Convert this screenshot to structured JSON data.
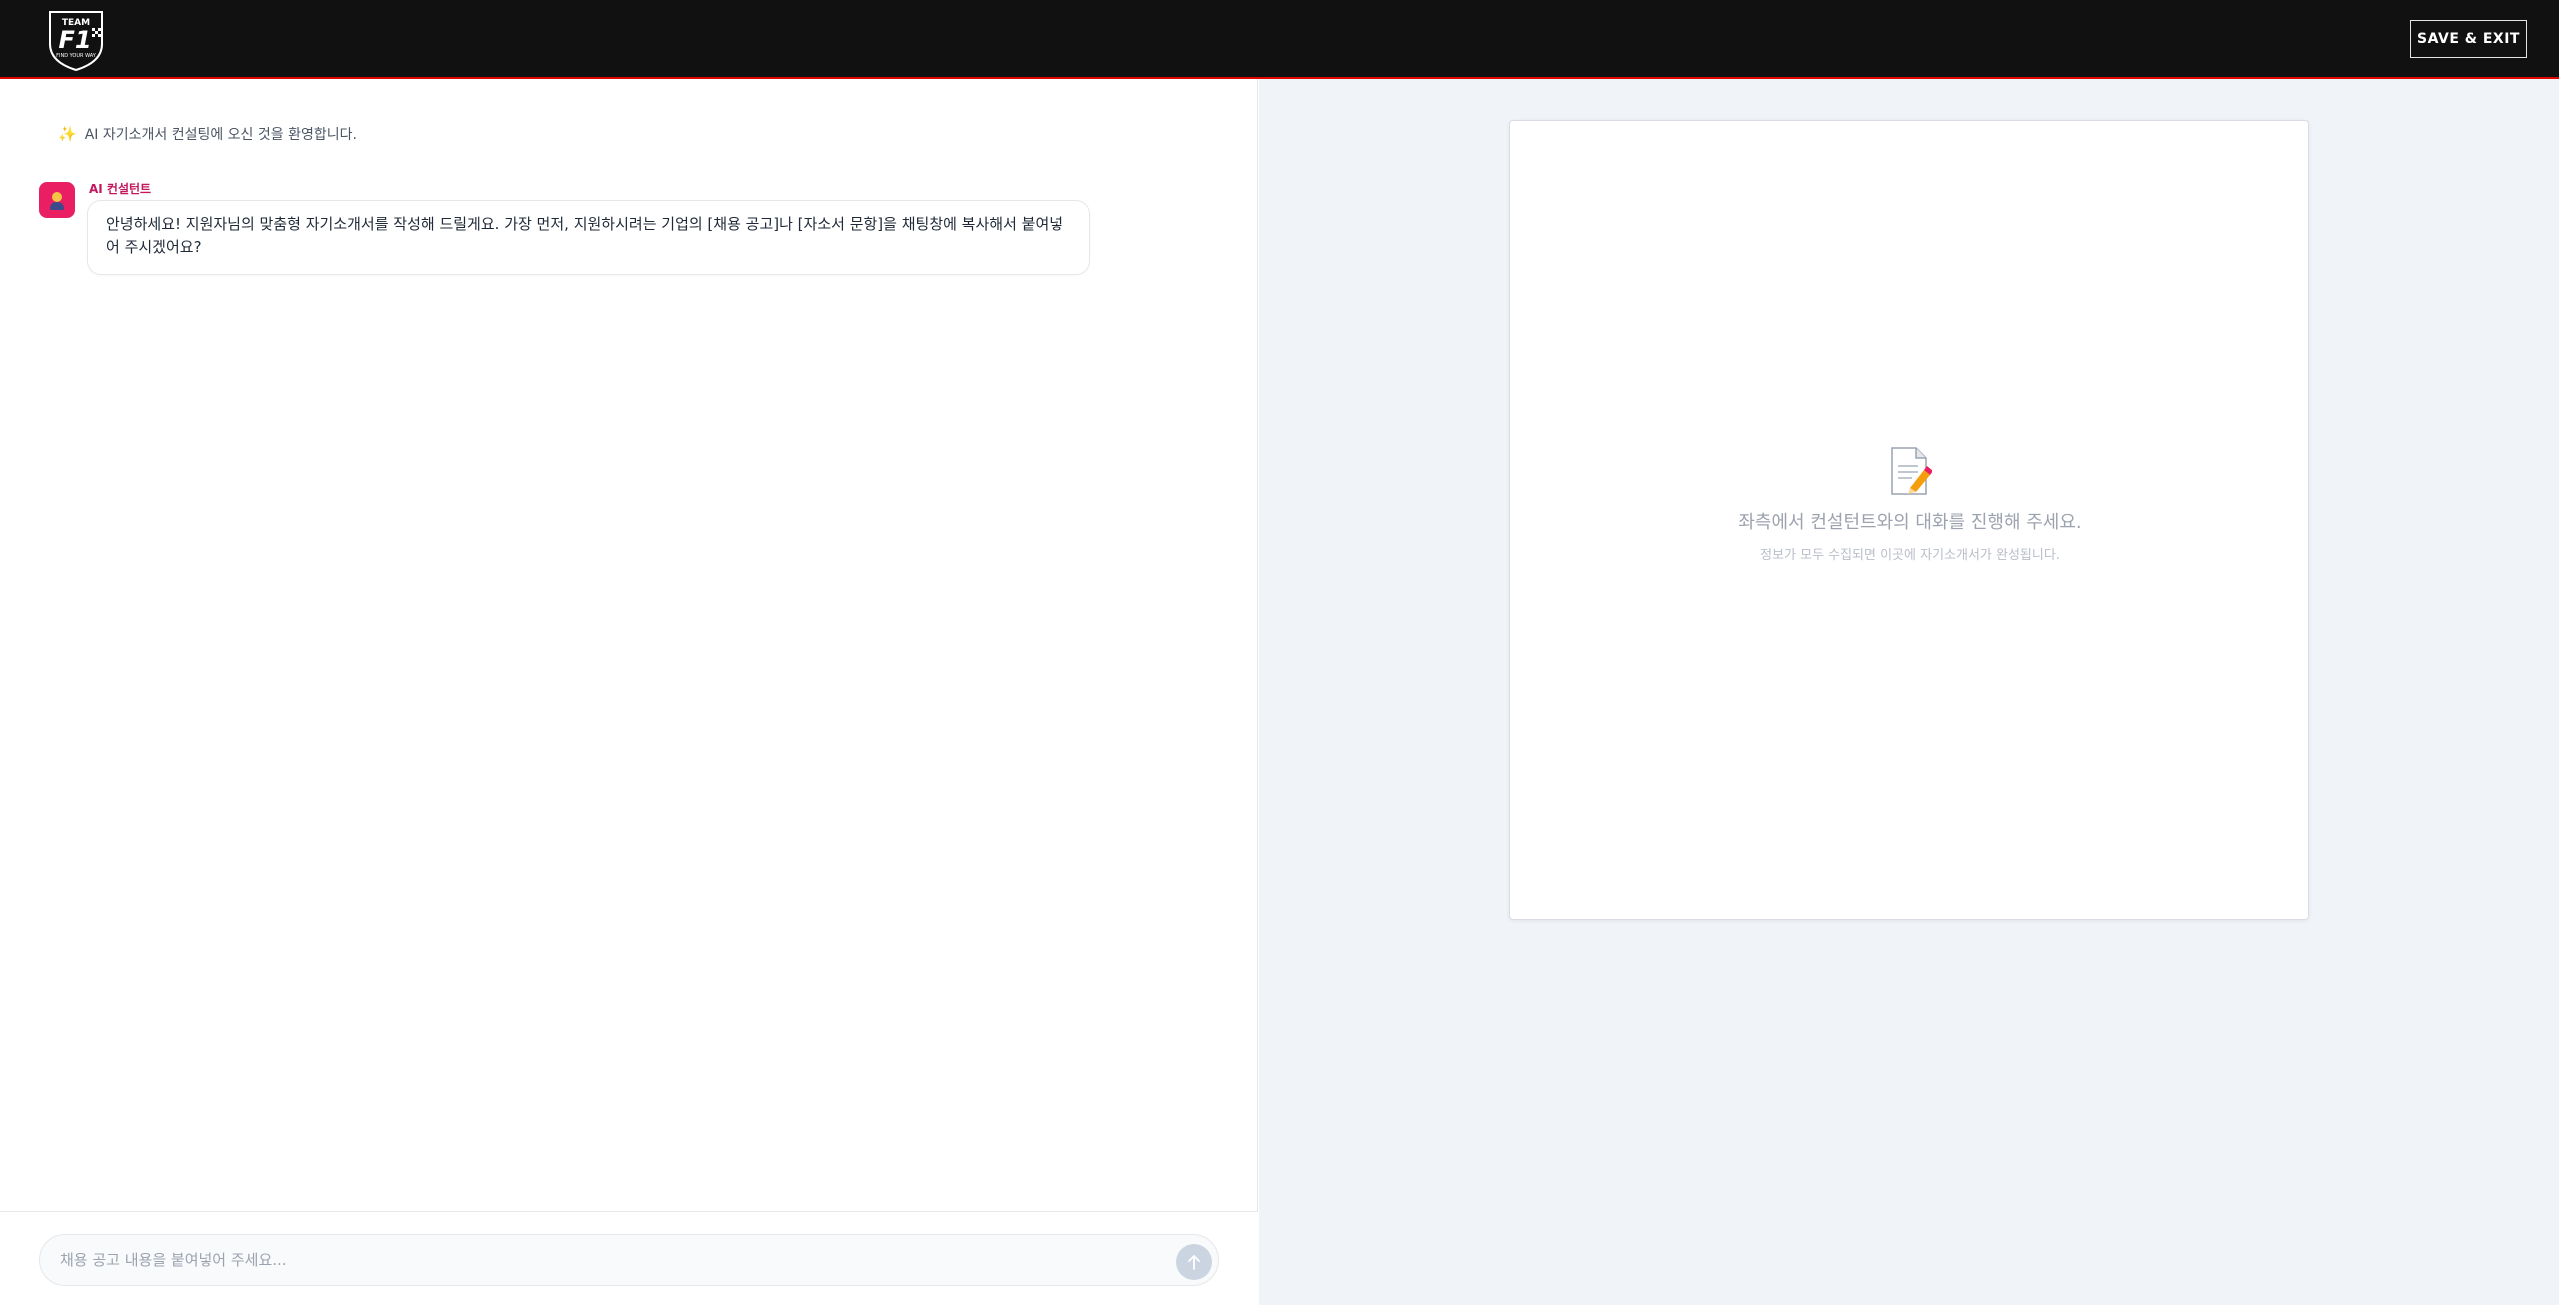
{
  "header": {
    "logo_text_top": "TEAM",
    "logo_text_main": "F1",
    "logo_text_bottom": "FIND YOUR WAY",
    "save_exit_label": "SAVE & EXIT",
    "accent_color": "#e10600"
  },
  "chat": {
    "welcome_icon": "sparkle-icon",
    "welcome_text": "AI 자기소개서 컨설팅에 오신 것을 환영합니다.",
    "messages": [
      {
        "sender": "AI 컨설턴트",
        "avatar_icon": "consultant-avatar-icon",
        "text": "안녕하세요! 지원자님의 맞춤형 자기소개서를 작성해 드릴게요. 가장 먼저, 지원하시려는 기업의 [채용 공고]나 [자소서 문항]을 채팅창에 복사해서 붙여넣어 주시겠어요?"
      }
    ],
    "input": {
      "placeholder": "채용 공고 내용을 붙여넣어 주세요...",
      "value": "",
      "send_icon": "arrow-up-icon"
    }
  },
  "preview": {
    "empty_icon": "document-pencil-icon",
    "empty_title": "좌측에서 컨설턴트와의 대화를 진행해 주세요.",
    "empty_subtitle": "정보가 모두 수집되면 이곳에 자기소개서가 완성됩니다."
  }
}
